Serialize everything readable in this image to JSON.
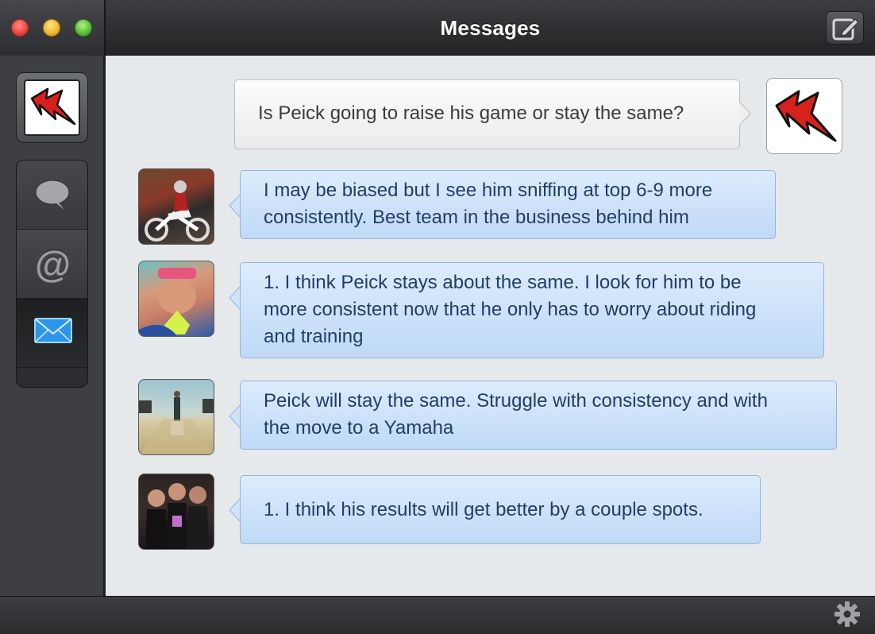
{
  "window": {
    "title": "Messages"
  },
  "sidebar": {
    "nav": [
      {
        "id": "timeline",
        "icon": "speech-bubble-icon"
      },
      {
        "id": "mentions",
        "icon": "at-sign-icon",
        "glyph": "@"
      },
      {
        "id": "messages",
        "icon": "envelope-icon",
        "active": true
      }
    ]
  },
  "colors": {
    "incoming_bubble": "#cfe3fa",
    "outgoing_bubble": "#f5f5f5",
    "incoming_text": "#213e63",
    "outgoing_text": "#3b3b3b",
    "active_nav_icon": "#3da6f7"
  },
  "messages": [
    {
      "direction": "outgoing",
      "lines": [
        "Is Peick going to raise his game or stay the same?"
      ]
    },
    {
      "direction": "incoming",
      "lines": [
        "I may be biased but I see him sniffing at top 6-9 more",
        "consistently. Best team in the business behind him"
      ]
    },
    {
      "direction": "incoming",
      "lines": [
        "1. I think Peick stays about the same. I look for him to be",
        "more consistent now that he only has to worry about riding",
        "and training"
      ]
    },
    {
      "direction": "incoming",
      "lines": [
        "Peick will stay the same. Struggle with consistency and with",
        "the move to a Yamaha"
      ]
    },
    {
      "direction": "incoming",
      "lines": [
        "1. I think his results will get better by a couple spots."
      ]
    }
  ]
}
